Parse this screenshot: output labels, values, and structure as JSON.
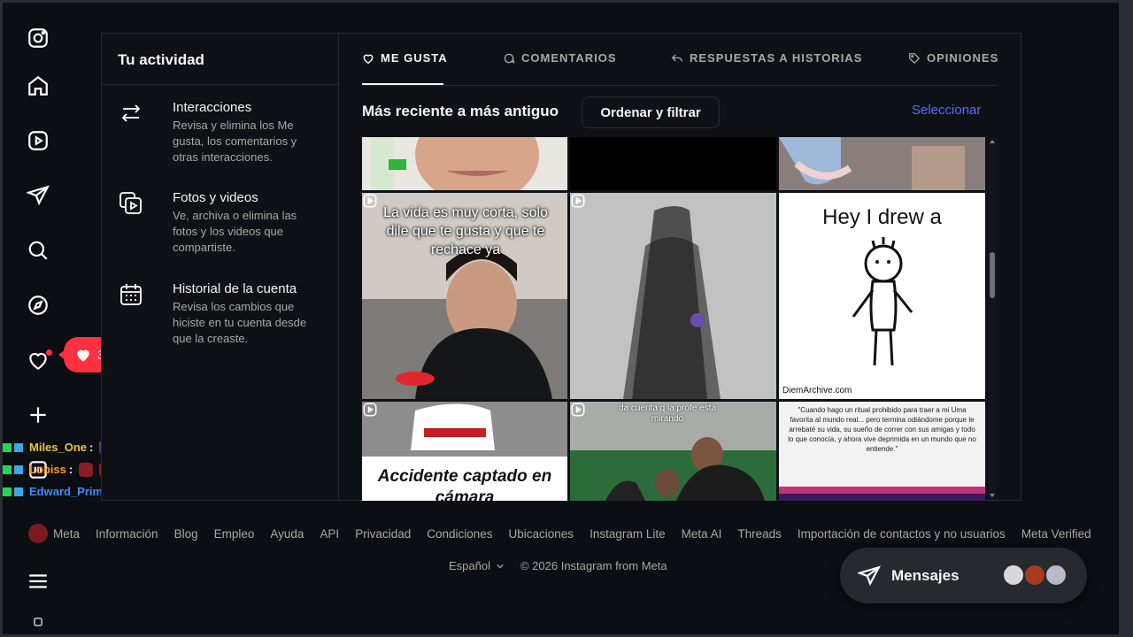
{
  "colors": {
    "accent": "#5b6bff",
    "notification": "#ff3040",
    "background": "#0b0e12"
  },
  "rail": {
    "icons": [
      "instagram-icon",
      "home-icon",
      "reels-icon",
      "messages-icon",
      "search-icon",
      "explore-icon",
      "heart-icon",
      "create-icon",
      "threads-icon",
      "menu-icon"
    ]
  },
  "notification": {
    "likes_count": "3"
  },
  "chat": [
    {
      "user": "Miles_One",
      "color": "#f0c040"
    },
    {
      "user": "Lobiss",
      "color": "#ff9a2e"
    },
    {
      "user": "Edward_Prime",
      "color": "#3d8bff"
    }
  ],
  "sidebar": {
    "title": "Tu actividad",
    "items": [
      {
        "title": "Interacciones",
        "desc": "Revisa y elimina los Me gusta, los comentarios y otras interacciones.",
        "icon": "arrows-icon"
      },
      {
        "title": "Fotos y videos",
        "desc": "Ve, archiva o elimina las fotos y los videos que compartiste.",
        "icon": "media-icon"
      },
      {
        "title": "Historial de la cuenta",
        "desc": "Revisa los cambios que hiciste en tu cuenta desde que la creaste.",
        "icon": "calendar-icon"
      }
    ]
  },
  "tabs": [
    {
      "label": "ME GUSTA",
      "icon": "heart-icon",
      "active": true
    },
    {
      "label": "COMENTARIOS",
      "icon": "comment-icon",
      "active": false
    },
    {
      "label": "RESPUESTAS A HISTORIAS",
      "icon": "reply-icon",
      "active": false
    },
    {
      "label": "OPINIONES",
      "icon": "tag-icon",
      "active": false
    }
  ],
  "toolbar": {
    "sort_label": "Más reciente a más antiguo",
    "filter_button": "Ordenar y filtrar",
    "select_link": "Seleccionar"
  },
  "grid": {
    "tile_captions": {
      "t4": "La vida es muy corta, solo dile que te gusta y que te rechace ya",
      "t6": "Hey I drew a",
      "t6_watermark": "DiemArchive.com",
      "t7": "Accidente captado en cámara",
      "t8": "da cuenta q la profe está mirando",
      "t9": "\"Cuando hago un ritual prohibido para traer a mi Uma favorita al mundo real... pero termina odiándome porque le arrebaté su vida, su sueño de correr con sus amigas y todo lo que conocía, y ahora vive deprimida en un mundo que no entiende.\""
    }
  },
  "footer": {
    "links": [
      "Meta",
      "Información",
      "Blog",
      "Empleo",
      "Ayuda",
      "API",
      "Privacidad",
      "Condiciones",
      "Ubicaciones",
      "Instagram Lite",
      "Meta AI",
      "Threads",
      "Importación de contactos y no usuarios",
      "Meta Verified"
    ],
    "language": "Español",
    "copyright": "© 2026 Instagram from Meta"
  },
  "messages": {
    "label": "Mensajes"
  }
}
